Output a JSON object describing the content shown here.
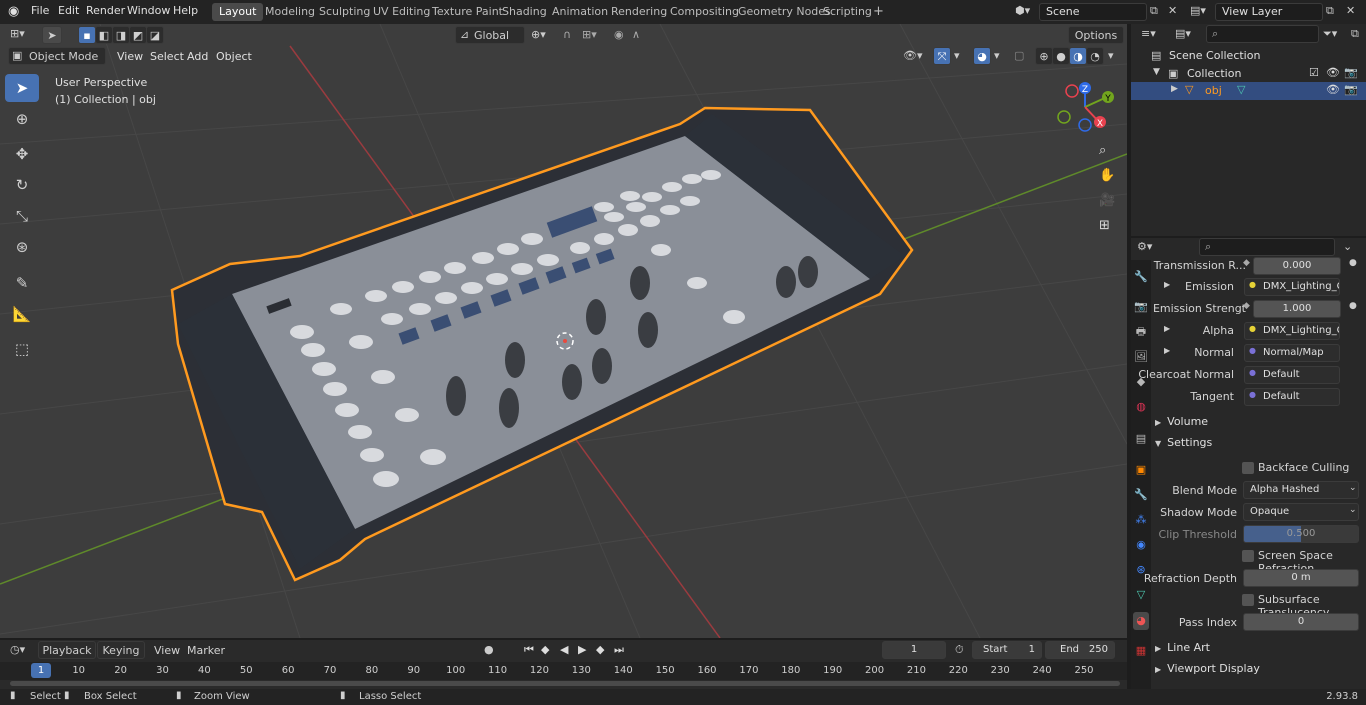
{
  "menu": {
    "file": "File",
    "edit": "Edit",
    "render": "Render",
    "window": "Window",
    "help": "Help"
  },
  "workspaces": [
    "Layout",
    "Modeling",
    "Sculpting",
    "UV Editing",
    "Texture Paint",
    "Shading",
    "Animation",
    "Rendering",
    "Compositing",
    "Geometry Nodes",
    "Scripting"
  ],
  "add_workspace": "+",
  "scene": {
    "name": "Scene",
    "view_layer": "View Layer"
  },
  "viewport_header": {
    "mode": "Object Mode",
    "view": "View",
    "select": "Select",
    "add": "Add",
    "object": "Object",
    "orientation": "Global",
    "options": "Options"
  },
  "viewport_overlay": {
    "perspective": "User Perspective",
    "collection": "(1) Collection | obj"
  },
  "gizmo": {
    "x": "X",
    "y": "Y",
    "z": "Z"
  },
  "colors": {
    "accent": "#4772b3",
    "selection": "#ff9a1f",
    "x_axis": "#e8424f",
    "y_axis": "#72a51e",
    "z_axis": "#2f6be8"
  },
  "outliner": {
    "search_placeholder": "",
    "scene_collection": "Scene Collection",
    "collection": "Collection",
    "object": "obj"
  },
  "properties": {
    "search_placeholder": "",
    "rows": [
      {
        "label": "Transmission R...",
        "value": "0.000",
        "kind": "num"
      },
      {
        "label": "Emission",
        "value": "DMX_Lighting_Contr...",
        "kind": "link"
      },
      {
        "label": "Emission Strengt",
        "value": "1.000",
        "kind": "num"
      },
      {
        "label": "Alpha",
        "value": "DMX_Lighting_Contr...",
        "kind": "link"
      },
      {
        "label": "Normal",
        "value": "Normal/Map",
        "kind": "link"
      },
      {
        "label": "Clearcoat Normal",
        "value": "Default",
        "kind": "link"
      },
      {
        "label": "Tangent",
        "value": "Default",
        "kind": "link"
      }
    ],
    "volume": "Volume",
    "settings": "Settings",
    "backface_culling": "Backface Culling",
    "blend_mode_label": "Blend Mode",
    "blend_mode": "Alpha Hashed",
    "shadow_mode_label": "Shadow Mode",
    "shadow_mode": "Opaque",
    "clip_threshold_label": "Clip Threshold",
    "clip_threshold": "0.500",
    "ssr": "Screen Space Refraction",
    "refraction_depth_label": "Refraction Depth",
    "refraction_depth": "0 m",
    "subsurface": "Subsurface Translucency",
    "pass_index_label": "Pass Index",
    "pass_index": "0",
    "line_art": "Line Art",
    "viewport_display": "Viewport Display"
  },
  "timeline": {
    "playback": "Playback",
    "keying": "Keying",
    "view": "View",
    "marker": "Marker",
    "current_frame": "1",
    "start_label": "Start",
    "start": "1",
    "end_label": "End",
    "end": "250",
    "ticks": [
      "1",
      "10",
      "20",
      "30",
      "40",
      "50",
      "60",
      "70",
      "80",
      "90",
      "100",
      "110",
      "120",
      "130",
      "140",
      "150",
      "160",
      "170",
      "180",
      "190",
      "200",
      "210",
      "220",
      "230",
      "240",
      "250"
    ]
  },
  "statusbar": {
    "select": "Select",
    "box_select": "Box Select",
    "zoom_view": "Zoom View",
    "lasso_select": "Lasso Select",
    "version": "2.93.8"
  }
}
